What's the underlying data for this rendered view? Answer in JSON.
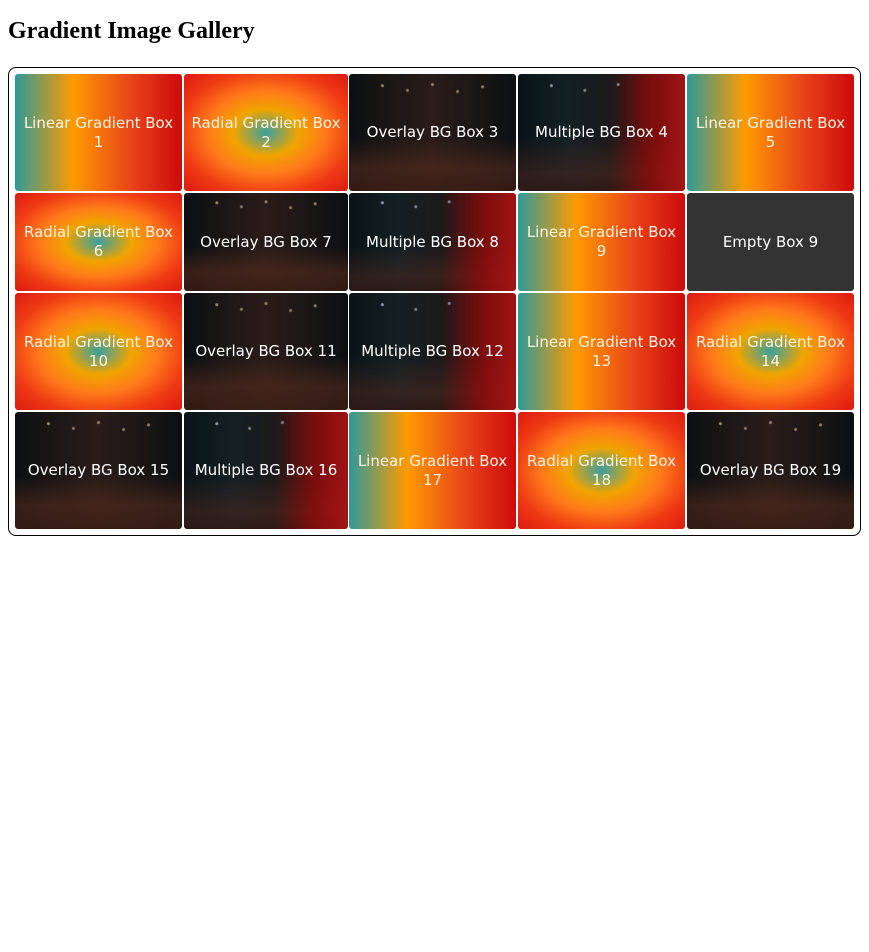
{
  "page": {
    "title": "Gradient Image Gallery"
  },
  "colors": {
    "linear_gradient": [
      "#2f9a98",
      "#ff9a00",
      "#e8421a",
      "#cc0b0b"
    ],
    "radial_gradient": [
      "#3aa0a0",
      "#f0a400",
      "#ff7a1a",
      "#dc1a10"
    ],
    "empty_box": "#333333",
    "gallery_border": "#000000"
  },
  "gallery": {
    "boxes": [
      {
        "label": "Linear Gradient Box 1",
        "style": "linear"
      },
      {
        "label": "Radial Gradient Box 2",
        "style": "radial"
      },
      {
        "label": "Overlay BG Box 3",
        "style": "overlay"
      },
      {
        "label": "Multiple BG Box 4",
        "style": "multiple"
      },
      {
        "label": "Linear Gradient Box 5",
        "style": "linear"
      },
      {
        "label": "Radial Gradient Box 6",
        "style": "radial"
      },
      {
        "label": "Overlay BG Box 7",
        "style": "overlay"
      },
      {
        "label": "Multiple BG Box 8",
        "style": "multiple"
      },
      {
        "label": "Linear Gradient Box 9",
        "style": "linear"
      },
      {
        "label": "Empty Box 9",
        "style": "empty"
      },
      {
        "label": "Radial Gradient Box 10",
        "style": "radial"
      },
      {
        "label": "Overlay BG Box 11",
        "style": "overlay"
      },
      {
        "label": "Multiple BG Box 12",
        "style": "multiple"
      },
      {
        "label": "Linear Gradient Box 13",
        "style": "linear"
      },
      {
        "label": "Radial Gradient Box 14",
        "style": "radial"
      },
      {
        "label": "Overlay BG Box 15",
        "style": "overlay"
      },
      {
        "label": "Multiple BG Box 16",
        "style": "multiple"
      },
      {
        "label": "Linear Gradient Box 17",
        "style": "linear"
      },
      {
        "label": "Radial Gradient Box 18",
        "style": "radial"
      },
      {
        "label": "Overlay BG Box 19",
        "style": "overlay"
      }
    ]
  }
}
